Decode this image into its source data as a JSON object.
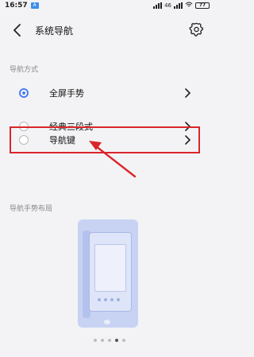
{
  "status_bar": {
    "time": "16:57",
    "app_badge": "A",
    "carrier_text": "46",
    "battery": "77"
  },
  "header": {
    "title": "系统导航"
  },
  "sections": {
    "nav_mode_label": "导航方式",
    "gesture_layout_label": "导航手势布局"
  },
  "options": [
    {
      "label": "全屏手势",
      "selected": true
    },
    {
      "label": "经典三段式",
      "selected": false
    },
    {
      "label": "导航键",
      "selected": false
    }
  ],
  "colors": {
    "accent": "#4a7cf0",
    "annotation": "#d9262b",
    "background": "#f3f3f5"
  },
  "pager": {
    "count": 5,
    "active_index": 3
  }
}
